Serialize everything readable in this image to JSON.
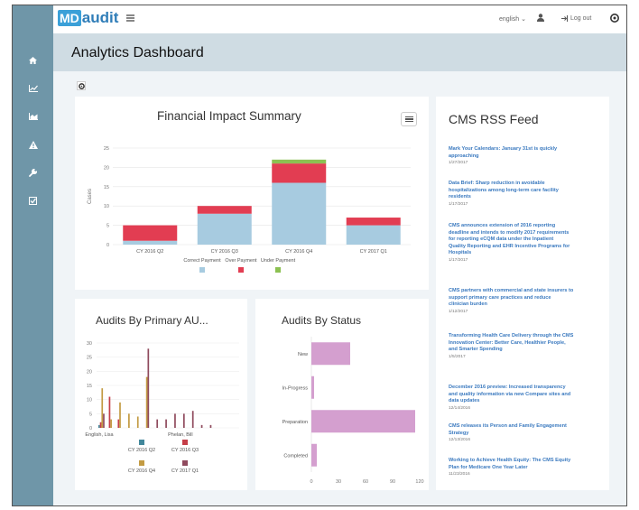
{
  "logo": {
    "md": "MD",
    "word": "audit"
  },
  "topbar": {
    "language": "english",
    "logout": "Log out"
  },
  "page_title": "Analytics Dashboard",
  "panels": {
    "financial": "Financial Impact Summary",
    "primary_au": "Audits By Primary AU...",
    "status": "Audits By Status",
    "rss": "CMS RSS Feed"
  },
  "colors": {
    "correct": "#a7cbe0",
    "over": "#e23d52",
    "under": "#8cc152",
    "teal": "#42879b",
    "red": "#c53e48",
    "gold": "#c39b43",
    "maroon": "#8f4a5d",
    "status_bar": "#d49fcf"
  },
  "icons": [
    "home-icon",
    "line-chart-icon",
    "area-chart-icon",
    "warning-icon",
    "wrench-icon",
    "checkbox-icon",
    "user-icon",
    "logout-icon",
    "settings-icon",
    "gear-icon",
    "hamburger-icon"
  ],
  "chart_data": [
    {
      "type": "bar",
      "stacked": true,
      "title": "Financial Impact Summary",
      "ylabel": "Cases",
      "categories": [
        "CY 2016 Q2",
        "CY 2016 Q3",
        "CY 2016 Q4",
        "CY 2017 Q1"
      ],
      "ylim": [
        0,
        25
      ],
      "yticks": [
        0,
        5,
        10,
        15,
        20,
        25
      ],
      "series": [
        {
          "name": "Correct Payment",
          "color": "#a7cbe0",
          "values": [
            1,
            8,
            16,
            5
          ]
        },
        {
          "name": "Over Payment",
          "color": "#e23d52",
          "values": [
            4,
            2,
            5,
            2
          ]
        },
        {
          "name": "Under Payment",
          "color": "#8cc152",
          "values": [
            0,
            0,
            1,
            0
          ]
        }
      ],
      "legend": "bottom"
    },
    {
      "type": "bar",
      "title": "Audits By Primary AU...",
      "categories": [
        "English, Lisa",
        "",
        "",
        "",
        "",
        "",
        "",
        "",
        "",
        "Phelan, Bill",
        "",
        "",
        "",
        "",
        "",
        ""
      ],
      "xtick_labels": [
        "English, Lisa",
        "Phelan, Bill"
      ],
      "ylim": [
        0,
        30
      ],
      "yticks": [
        0,
        5,
        10,
        15,
        20,
        25,
        30
      ],
      "series": [
        {
          "name": "CY 2016 Q2",
          "color": "#42879b",
          "values": [
            1,
            0,
            0,
            0,
            0,
            0,
            0,
            0,
            0,
            0,
            0,
            0,
            0,
            0,
            0,
            0
          ]
        },
        {
          "name": "CY 2016 Q3",
          "color": "#c53e48",
          "values": [
            2,
            11,
            3,
            0,
            0,
            0,
            0,
            0,
            0,
            0,
            0,
            0,
            0,
            0,
            0,
            0
          ]
        },
        {
          "name": "CY 2016 Q4",
          "color": "#c39b43",
          "values": [
            14,
            3,
            9,
            5,
            4,
            18,
            0,
            0,
            0,
            0,
            0,
            0,
            0,
            0,
            0,
            0
          ]
        },
        {
          "name": "CY 2017 Q1",
          "color": "#8f4a5d",
          "values": [
            5,
            0,
            0,
            0,
            0,
            28,
            3,
            3,
            5,
            5,
            6,
            1,
            1,
            0,
            0,
            0
          ]
        }
      ],
      "legend": "bottom"
    },
    {
      "type": "bar",
      "orientation": "horizontal",
      "title": "Audits By Status",
      "categories": [
        "New",
        "In-Progress",
        "Preparation",
        "Completed"
      ],
      "values": [
        43,
        3,
        115,
        6
      ],
      "xlim": [
        0,
        120
      ],
      "xticks": [
        0,
        30,
        60,
        90,
        120
      ],
      "color": "#d49fcf"
    }
  ],
  "rss": [
    {
      "title": [
        "Mark Your Calendars: January 31st is quickly",
        "approaching"
      ],
      "date": "1/27/2017"
    },
    {
      "title": [
        "Data Brief: Sharp reduction in avoidable",
        "hospitalizations among long-term care facility",
        "residents"
      ],
      "date": "1/17/2017"
    },
    {
      "title": [
        "CMS announces extension of 2016 reporting",
        "deadline and intends to modify 2017 requirements",
        "for reporting eCQM data under the Inpatient",
        "Quality Reporting and EHR Incentive Programs for",
        "Hospitals"
      ],
      "date": "1/17/2017"
    },
    {
      "title": [
        "CMS partners with commercial and state insurers to",
        "support primary care practices and reduce",
        "clinician burden"
      ],
      "date": "1/12/2017"
    },
    {
      "title": [
        "Transforming Health Care Delivery through the CMS",
        "Innovation Center: Better Care, Healthier People,",
        "and Smarter Spending"
      ],
      "date": "1/5/2017"
    },
    {
      "title": [
        "December 2016 preview: Increased transparency",
        "and quality information via new Compare sites and",
        "data updates"
      ],
      "date": "12/14/2016"
    },
    {
      "title": [
        "CMS releases its Person and Family Engagement",
        "Strategy"
      ],
      "date": "12/13/2016"
    },
    {
      "title": [
        "Working to Achieve Health Equity: The CMS Equity",
        "Plan for Medicare One Year Later"
      ],
      "date": "11/23/2016"
    }
  ]
}
